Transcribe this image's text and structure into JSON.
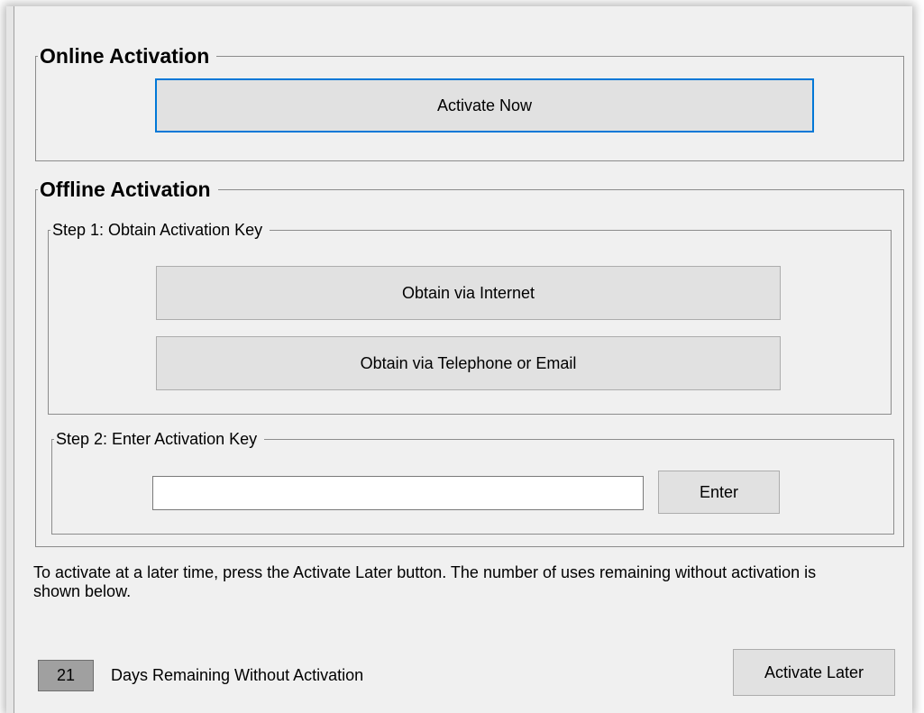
{
  "online_activation": {
    "title": "Online Activation",
    "activate_now_label": "Activate Now"
  },
  "offline_activation": {
    "title": "Offline Activation",
    "step1": {
      "title": "Step 1: Obtain Activation Key",
      "obtain_internet_label": "Obtain via Internet",
      "obtain_phone_email_label": "Obtain via Telephone or Email"
    },
    "step2": {
      "title": "Step 2: Enter Activation Key",
      "key_value": "",
      "enter_label": "Enter"
    }
  },
  "info_text": "To activate at a later time, press the Activate Later button. The number of uses remaining without activation is shown below.",
  "remaining": {
    "count": "21",
    "label": "Days Remaining Without Activation"
  },
  "activate_later_label": "Activate Later",
  "colors": {
    "focus_accent": "#0078d7",
    "window_bg": "#f0f0f0",
    "button_bg": "#e1e1e1"
  }
}
